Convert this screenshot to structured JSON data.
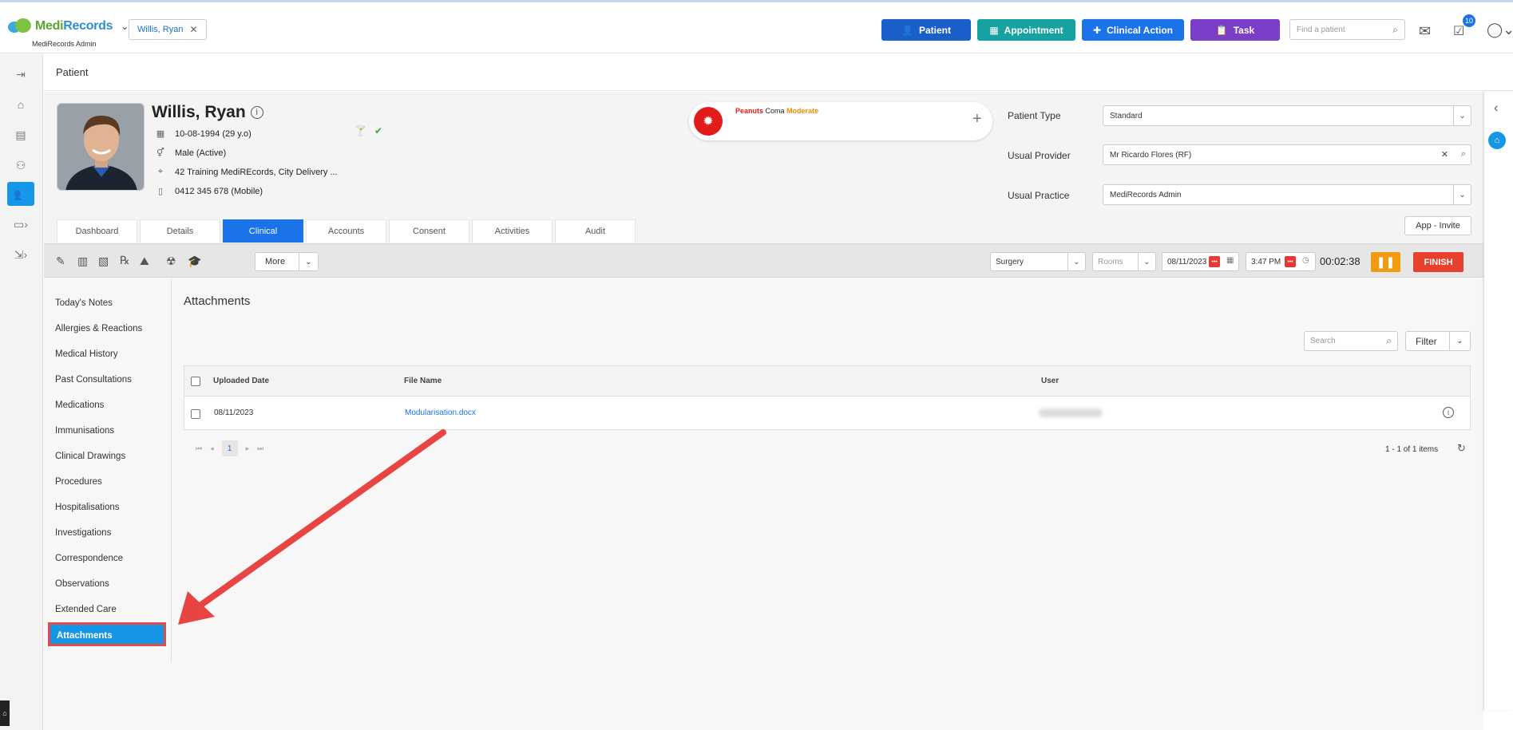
{
  "header": {
    "logo_name_a": "Medi",
    "logo_name_b": "Records",
    "logo_sub": "MediRecords Admin",
    "patient_chip": "Willis, Ryan",
    "buttons": [
      {
        "label": "Patient",
        "color": "#1a5fc9"
      },
      {
        "label": "Appointment",
        "color": "#17a2a2"
      },
      {
        "label": "Clinical Action",
        "color": "#1a73e8"
      },
      {
        "label": "Task",
        "color": "#7a3ec8"
      }
    ],
    "search_placeholder": "Find a patient",
    "notification_count": "10"
  },
  "page_title": "Patient",
  "patient": {
    "name": "Willis, Ryan",
    "dob": "10-08-1994 (29 y.o)",
    "gender": "Male (Active)",
    "address": "42 Training MediREcords, City Delivery ...",
    "phone": "0412 345 678 (Mobile)"
  },
  "allergy": {
    "substance": "Peanuts",
    "reaction": "Coma",
    "severity": "Moderate"
  },
  "fields": {
    "patient_type_label": "Patient Type",
    "patient_type_value": "Standard",
    "usual_provider_label": "Usual Provider",
    "usual_provider_value": "Mr Ricardo Flores (RF)",
    "usual_practice_label": "Usual Practice",
    "usual_practice_value": "MediRecords Admin"
  },
  "app_invite": "App - Invite",
  "tabs": [
    "Dashboard",
    "Details",
    "Clinical",
    "Accounts",
    "Consent",
    "Activities",
    "Audit"
  ],
  "active_tab": "Clinical",
  "toolbar": {
    "more_label": "More",
    "location": "Surgery",
    "rooms_placeholder": "Rooms",
    "date": "08/11/2023",
    "time": "3:47 PM",
    "timer": "00:02:38",
    "finish_label": "FINISH"
  },
  "side_nav": [
    "Today's Notes",
    "Allergies & Reactions",
    "Medical History",
    "Past Consultations",
    "Medications",
    "Immunisations",
    "Clinical Drawings",
    "Procedures",
    "Hospitalisations",
    "Investigations",
    "Correspondence",
    "Observations",
    "Extended Care",
    "Attachments"
  ],
  "active_nav": "Attachments",
  "attachments": {
    "title": "Attachments",
    "search_placeholder": "Search",
    "filter_label": "Filter",
    "columns": [
      "Uploaded Date",
      "File Name",
      "User"
    ],
    "rows": [
      {
        "uploaded_date": "08/11/2023",
        "file_name": "Modularisation.docx"
      }
    ],
    "current_page": "1",
    "pager_info": "1 - 1 of 1 items"
  }
}
